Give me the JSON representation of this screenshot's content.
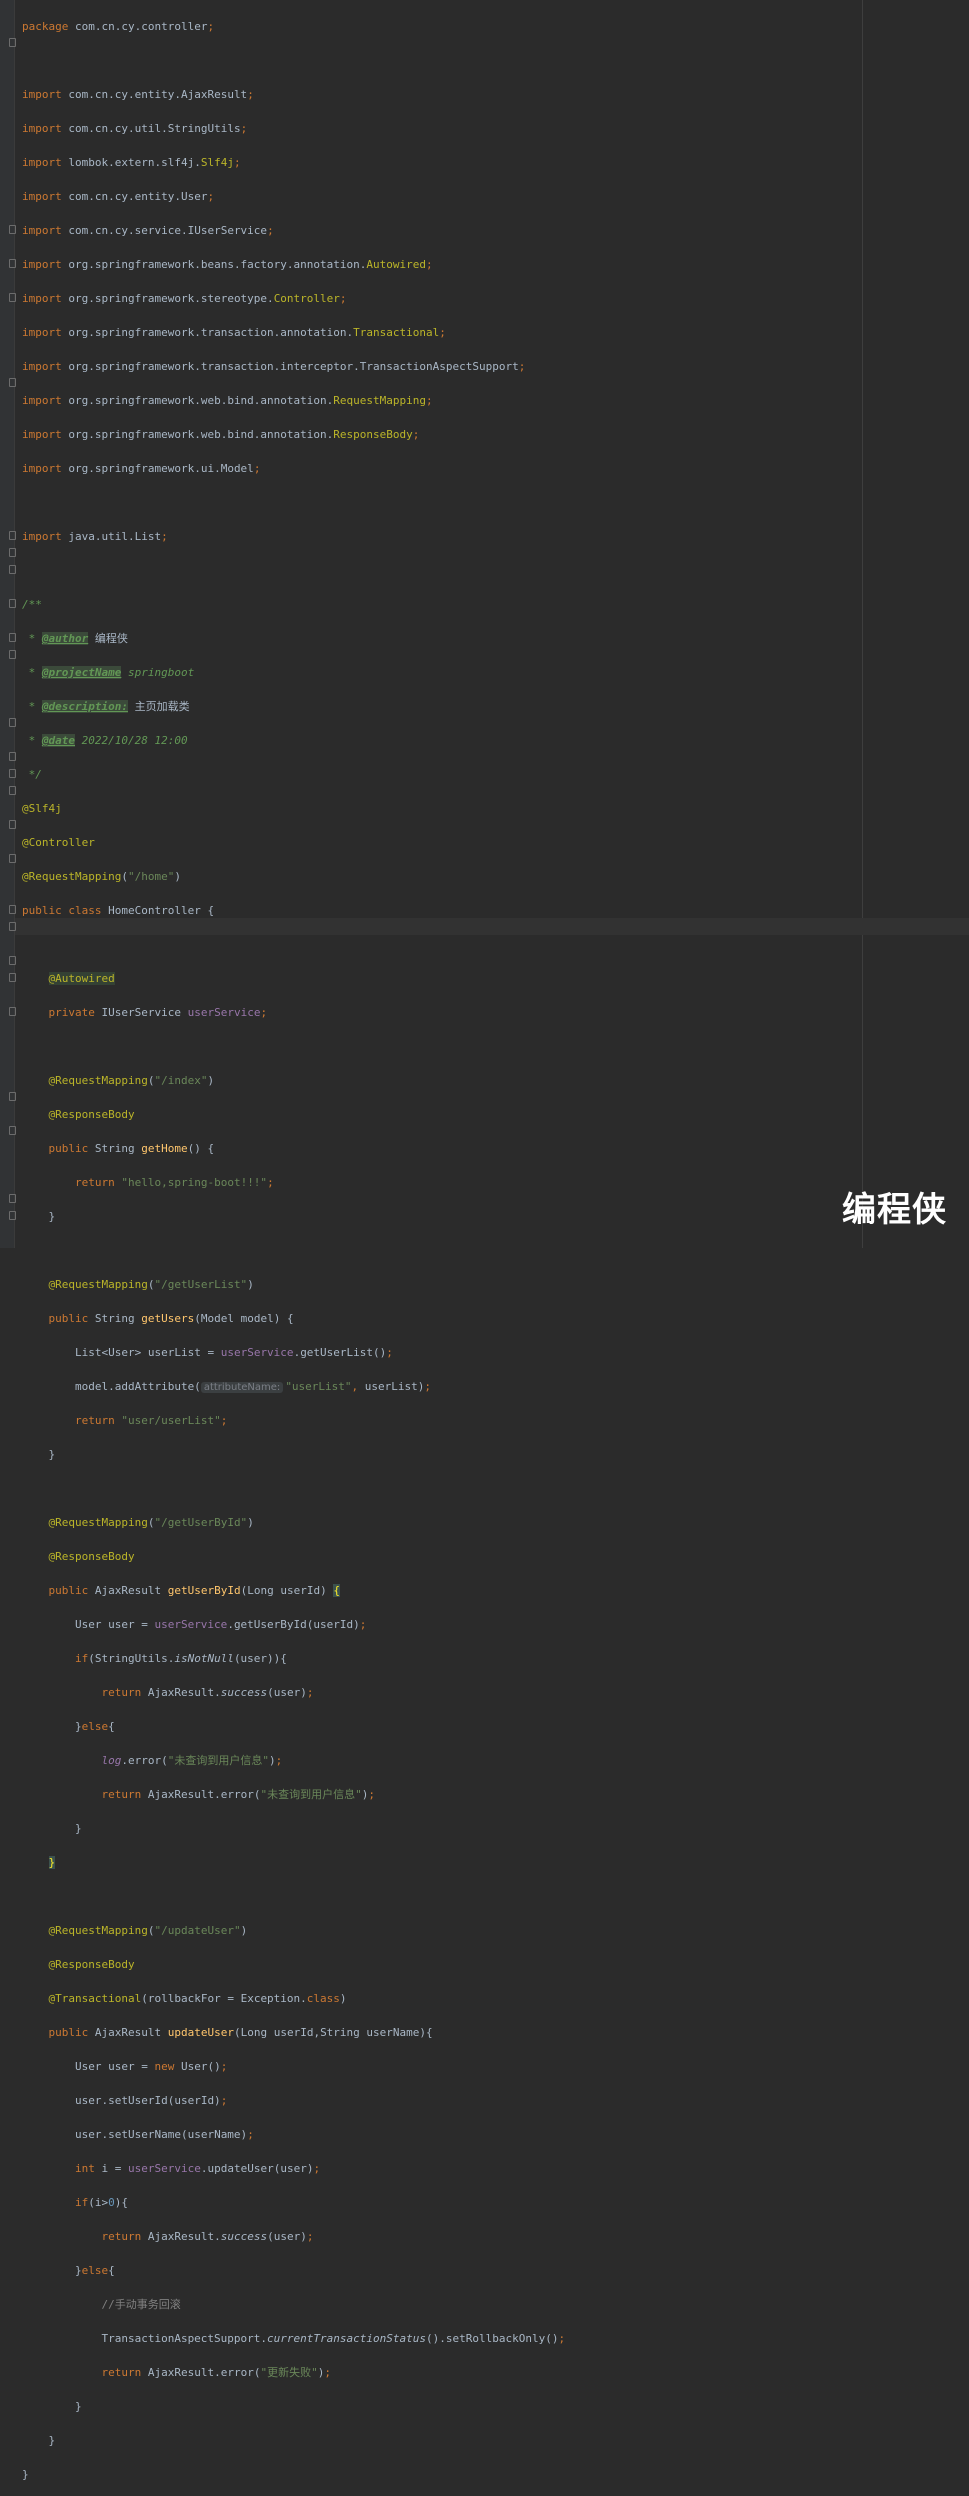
{
  "editor": {
    "package_keyword": "package",
    "package_name": "com.cn.cy.controller",
    "imports": [
      {
        "path": "com.cn.cy.entity.AjaxResult"
      },
      {
        "path": "com.cn.cy.util.StringUtils"
      },
      {
        "path": "lombok.extern.slf4j.",
        "cls": "Slf4j"
      },
      {
        "path": "com.cn.cy.entity.User"
      },
      {
        "path": "com.cn.cy.service.IUserService"
      },
      {
        "path": "org.springframework.beans.factory.annotation.",
        "cls": "Autowired"
      },
      {
        "path": "org.springframework.stereotype.",
        "cls": "Controller"
      },
      {
        "path": "org.springframework.transaction.annotation.",
        "cls": "Transactional"
      },
      {
        "path": "org.springframework.transaction.interceptor.TransactionAspectSupport"
      },
      {
        "path": "org.springframework.web.bind.annotation.",
        "cls": "RequestMapping"
      },
      {
        "path": "org.springframework.web.bind.annotation.",
        "cls": "ResponseBody"
      },
      {
        "path": "org.springframework.ui.Model"
      }
    ],
    "import_list": "java.util.List",
    "doc": {
      "author_tag": "@author",
      "author": "编程侠",
      "project_tag": "@projectName",
      "project": "springboot",
      "desc_tag": "@description:",
      "desc": "主页加载类",
      "date_tag": "@date",
      "date": "2022/10/28 12:00"
    },
    "class_annotations": [
      "@Slf4j",
      "@Controller",
      "@RequestMapping"
    ],
    "class_mapping": "\"/home\"",
    "class_name": "HomeController",
    "field_annotation": "@Autowired",
    "field_type": "IUserService",
    "field_name": "userService",
    "methods": {
      "get_home": {
        "mapping": "\"/index\"",
        "name": "getHome",
        "return_value": "\"hello,spring-boot!!!\""
      },
      "get_users": {
        "mapping": "\"/getUserList\"",
        "name": "getUsers",
        "params": "Model model",
        "list_var": "userList",
        "service_call": "getUserList",
        "param_hint": "attributeName:",
        "attr_key": "\"userList\"",
        "return_value": "\"user/userList\""
      },
      "get_user_by_id": {
        "mapping": "\"/getUserById\"",
        "name": "getUserById",
        "params": "Long userId",
        "service_call": "getUserById",
        "check": "isNotNull",
        "success": "success",
        "log_field": "log",
        "log_msg": "\"未查询到用户信息\"",
        "error_msg": "\"未查询到用户信息\""
      },
      "update_user": {
        "mapping": "\"/updateUser\"",
        "transactional_arg": "rollbackFor",
        "name": "updateUser",
        "params": "Long userId,String userName",
        "set_id": "setUserId",
        "set_name": "setUserName",
        "service_call": "updateUser",
        "compare": "0",
        "success": "success",
        "comment": "//手动事务回滚",
        "rollback_call": "currentTransactionStatus",
        "rollback_method": "setRollbackOnly",
        "error_msg": "\"更新失败\""
      }
    }
  },
  "watermark": "编程侠",
  "colors": {
    "background": "#2b2b2b",
    "keyword": "#cc7832",
    "string": "#6a8759",
    "annotation": "#bbb529",
    "field": "#9876aa",
    "method": "#ffc66d",
    "number": "#6897bb",
    "doc_comment": "#629755",
    "default_text": "#a9b7c6"
  }
}
